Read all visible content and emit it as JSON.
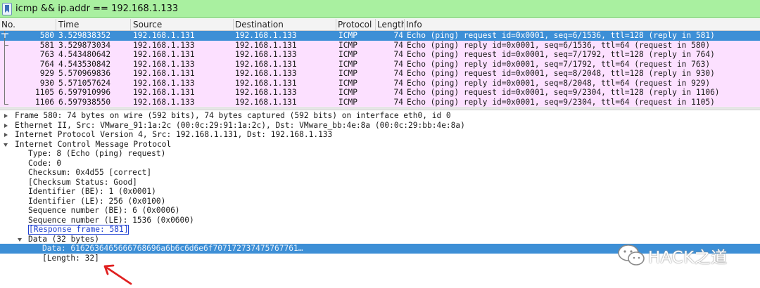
{
  "filter": {
    "value": "icmp && ip.addr == 192.168.1.133"
  },
  "columns": [
    "No.",
    "Time",
    "Source",
    "Destination",
    "Protocol",
    "Length",
    "Info"
  ],
  "packets": [
    {
      "no": "580",
      "time": "3.529838352",
      "src": "192.168.1.131",
      "dst": "192.168.1.133",
      "proto": "ICMP",
      "len": "74",
      "info": "Echo (ping) request  id=0x0001, seq=6/1536, ttl=128 (reply in 581)"
    },
    {
      "no": "581",
      "time": "3.529873034",
      "src": "192.168.1.133",
      "dst": "192.168.1.131",
      "proto": "ICMP",
      "len": "74",
      "info": "Echo (ping) reply    id=0x0001, seq=6/1536, ttl=64 (request in 580)"
    },
    {
      "no": "763",
      "time": "4.543480642",
      "src": "192.168.1.131",
      "dst": "192.168.1.133",
      "proto": "ICMP",
      "len": "74",
      "info": "Echo (ping) request  id=0x0001, seq=7/1792, ttl=128 (reply in 764)"
    },
    {
      "no": "764",
      "time": "4.543530842",
      "src": "192.168.1.133",
      "dst": "192.168.1.131",
      "proto": "ICMP",
      "len": "74",
      "info": "Echo (ping) reply    id=0x0001, seq=7/1792, ttl=64 (request in 763)"
    },
    {
      "no": "929",
      "time": "5.570969836",
      "src": "192.168.1.131",
      "dst": "192.168.1.133",
      "proto": "ICMP",
      "len": "74",
      "info": "Echo (ping) request  id=0x0001, seq=8/2048, ttl=128 (reply in 930)"
    },
    {
      "no": "930",
      "time": "5.571057624",
      "src": "192.168.1.133",
      "dst": "192.168.1.131",
      "proto": "ICMP",
      "len": "74",
      "info": "Echo (ping) reply    id=0x0001, seq=8/2048, ttl=64 (request in 929)"
    },
    {
      "no": "1105",
      "time": "6.597910996",
      "src": "192.168.1.131",
      "dst": "192.168.1.133",
      "proto": "ICMP",
      "len": "74",
      "info": "Echo (ping) request  id=0x0001, seq=9/2304, ttl=128 (reply in 1106)"
    },
    {
      "no": "1106",
      "time": "6.597938550",
      "src": "192.168.1.133",
      "dst": "192.168.1.131",
      "proto": "ICMP",
      "len": "74",
      "info": "Echo (ping) reply    id=0x0001, seq=9/2304, ttl=64 (request in 1105)"
    }
  ],
  "details": [
    {
      "text": "Frame 580: 74 bytes on wire (592 bits), 74 bytes captured (592 bits) on interface eth0, id 0",
      "expander": "closed"
    },
    {
      "text": "Ethernet II, Src: VMware_91:1a:2c (00:0c:29:91:1a:2c), Dst: VMware_bb:4e:8a (00:0c:29:bb:4e:8a)",
      "expander": "closed"
    },
    {
      "text": "Internet Protocol Version 4, Src: 192.168.1.131, Dst: 192.168.1.133",
      "expander": "closed"
    },
    {
      "text": "Internet Control Message Protocol",
      "expander": "open"
    },
    {
      "text": "Type: 8 (Echo (ping) request)"
    },
    {
      "text": "Code: 0"
    },
    {
      "text": "Checksum: 0x4d55 [correct]"
    },
    {
      "text": "[Checksum Status: Good]"
    },
    {
      "text": "Identifier (BE): 1 (0x0001)"
    },
    {
      "text": "Identifier (LE): 256 (0x0100)"
    },
    {
      "text": "Sequence number (BE): 6 (0x0006)"
    },
    {
      "text": "Sequence number (LE): 1536 (0x0600)"
    },
    {
      "text": "[Response frame: 581]",
      "link": true
    },
    {
      "text": "Data (32 bytes)",
      "expander": "open"
    },
    {
      "text": "Data: 6162636465666768696a6b6c6d6e6f707172737475767761…",
      "selected": true
    },
    {
      "text": "[Length: 32]"
    }
  ],
  "watermark": {
    "text": "HACK之道"
  },
  "colors": {
    "filter_bg": "#a9f0a0",
    "row_bg": "#fce0ff",
    "selected": "#3d8fd6",
    "arrow": "#e02020"
  }
}
